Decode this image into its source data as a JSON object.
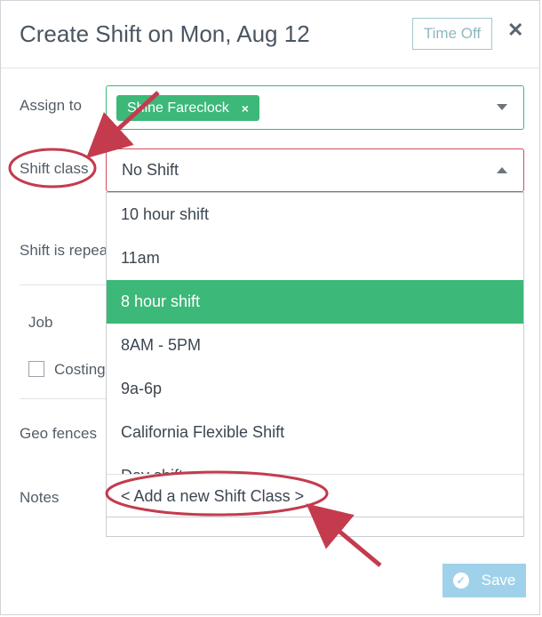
{
  "modal": {
    "title": "Create Shift on Mon, Aug 12",
    "time_off_label": "Time Off",
    "close_symbol": "✕"
  },
  "form": {
    "assign_to_label": "Assign to",
    "assignee_tag": "Shine Fareclock",
    "tag_remove_symbol": "×",
    "shift_class_label": "Shift class",
    "shift_class_value": "No Shift",
    "repeat_label": "Shift is repea",
    "job_label": "Job",
    "costing_label": "Costing",
    "geo_fences_label": "Geo fences",
    "notes_label": "Notes"
  },
  "dropdown": {
    "options": [
      {
        "label": "10 hour shift",
        "selected": false
      },
      {
        "label": "11am",
        "selected": false
      },
      {
        "label": "8 hour shift",
        "selected": true
      },
      {
        "label": "8AM - 5PM",
        "selected": false
      },
      {
        "label": "9a-6p",
        "selected": false
      },
      {
        "label": "California Flexible Shift",
        "selected": false
      },
      {
        "label": "Day shift",
        "selected": false
      }
    ],
    "add_new_label": "< Add a new Shift Class >"
  },
  "footer": {
    "save_label": "Save",
    "save_icon": "check-circle-icon"
  },
  "colors": {
    "accent_green": "#3cb878",
    "annotation_red": "#c43b4e",
    "save_blue": "#9fd2ea"
  }
}
